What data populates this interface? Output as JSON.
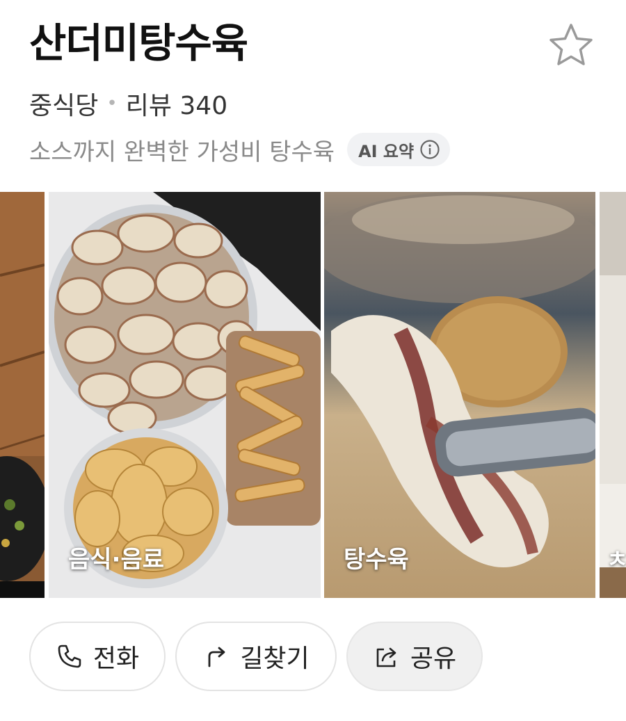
{
  "place": {
    "name": "산더미탕수육",
    "category": "중식당",
    "separator": "•",
    "review_text": "리뷰 340",
    "summary": "소스까지 완벽한 가성비 탕수육",
    "ai_badge": "AI 요약"
  },
  "photos": [
    {
      "caption": ""
    },
    {
      "caption": "음식·음료"
    },
    {
      "caption": "탕수육"
    },
    {
      "caption": "ㅊ"
    }
  ],
  "actions": {
    "call": "전화",
    "route": "길찾기",
    "share": "공유"
  },
  "icons": {
    "favorite": "star-outline-icon",
    "info": "info-circle-icon",
    "call": "phone-icon",
    "route": "route-arrow-icon",
    "share": "share-icon"
  },
  "colors": {
    "title": "#111111",
    "muted": "#8a8a8a",
    "badge_bg": "#f1f2f4"
  }
}
